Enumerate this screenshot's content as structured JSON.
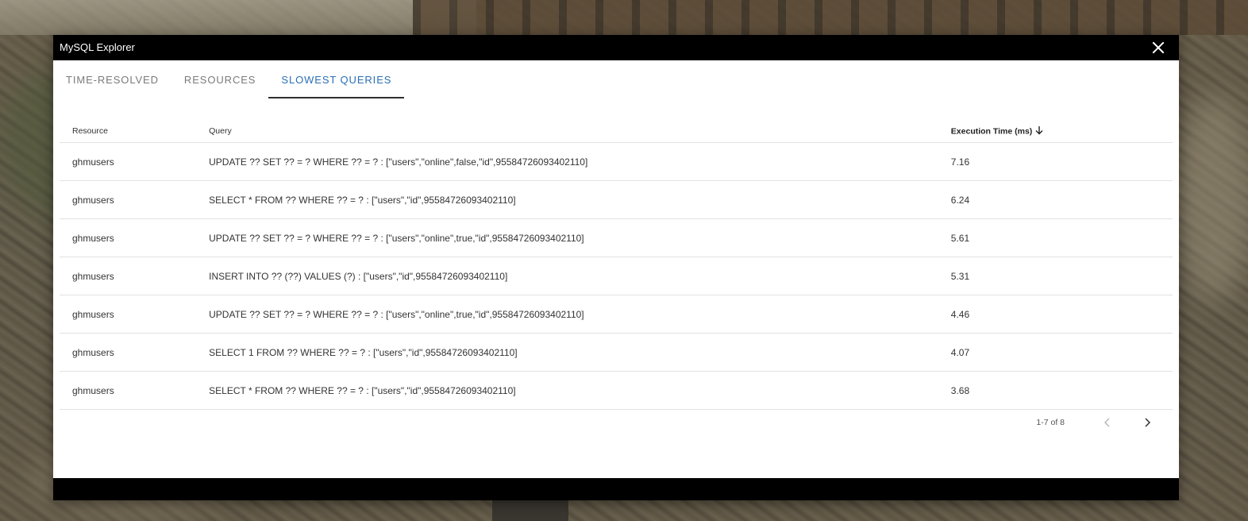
{
  "window": {
    "title": "MySQL Explorer"
  },
  "tabs": [
    {
      "label": "TIME-RESOLVED",
      "active": false
    },
    {
      "label": "RESOURCES",
      "active": false
    },
    {
      "label": "SLOWEST QUERIES",
      "active": true
    }
  ],
  "table": {
    "headers": {
      "resource": "Resource",
      "query": "Query",
      "execution_time": "Execution Time (ms)"
    },
    "sort": {
      "column": "execution_time",
      "direction": "descending",
      "icon": "arrow-down-icon"
    },
    "rows": [
      {
        "resource": "ghmusers",
        "query": "UPDATE ?? SET ?? = ? WHERE ?? = ? : [\"users\",\"online\",false,\"id\",95584726093402110]",
        "time": "7.16"
      },
      {
        "resource": "ghmusers",
        "query": "SELECT * FROM ?? WHERE ?? = ? : [\"users\",\"id\",95584726093402110]",
        "time": "6.24"
      },
      {
        "resource": "ghmusers",
        "query": "UPDATE ?? SET ?? = ? WHERE ?? = ? : [\"users\",\"online\",true,\"id\",95584726093402110]",
        "time": "5.61"
      },
      {
        "resource": "ghmusers",
        "query": "INSERT INTO ?? (??) VALUES (?) : [\"users\",\"id\",95584726093402110]",
        "time": "5.31"
      },
      {
        "resource": "ghmusers",
        "query": "UPDATE ?? SET ?? = ? WHERE ?? = ? : [\"users\",\"online\",true,\"id\",95584726093402110]",
        "time": "4.46"
      },
      {
        "resource": "ghmusers",
        "query": "SELECT 1 FROM ?? WHERE ?? = ? : [\"users\",\"id\",95584726093402110]",
        "time": "4.07"
      },
      {
        "resource": "ghmusers",
        "query": "SELECT * FROM ?? WHERE ?? = ? : [\"users\",\"id\",95584726093402110]",
        "time": "3.68"
      }
    ]
  },
  "pagination": {
    "range_text": "1-7 of 8",
    "prev_icon": "chevron-left-icon",
    "next_icon": "chevron-right-icon",
    "prev_enabled": false,
    "next_enabled": true
  },
  "colors": {
    "titlebar": "#000000",
    "active_tab": "#2a6fb3",
    "inactive_tab": "#7a7a7a"
  }
}
